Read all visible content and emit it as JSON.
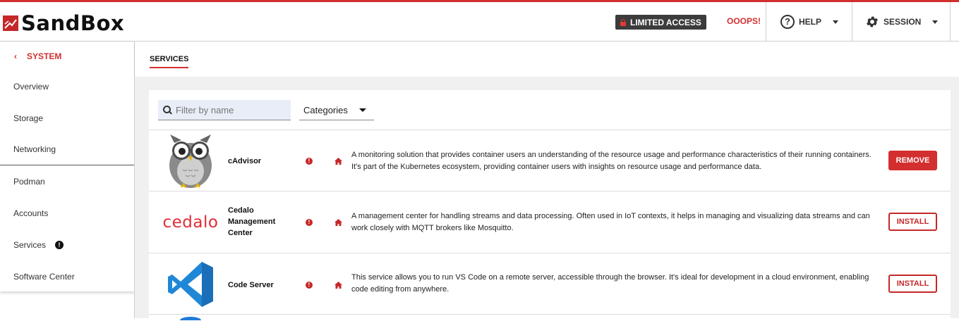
{
  "app": {
    "name": "SandBox"
  },
  "header": {
    "limited_access": "LIMITED ACCESS",
    "ooops": "OOOPS!",
    "help": "HELP",
    "session": "SESSION"
  },
  "sidebar": {
    "back_label": "SYSTEM",
    "items": [
      {
        "label": "Overview"
      },
      {
        "label": "Storage"
      },
      {
        "label": "Networking"
      },
      {
        "label": "Podman"
      },
      {
        "label": "Accounts"
      },
      {
        "label": "Services",
        "badge": "!"
      },
      {
        "label": "Software Center"
      }
    ]
  },
  "page": {
    "tab": "SERVICES",
    "filter_placeholder": "Filter by name",
    "categories_label": "Categories"
  },
  "services": [
    {
      "name": "cAdvisor",
      "description": "A monitoring solution that provides container users an understanding of the resource usage and performance characteristics of their running containers. It's part of the Kubernetes ecosystem, providing container users with insights on resource usage and performance data.",
      "action": "REMOVE",
      "installed": true,
      "logo": "owl-icon"
    },
    {
      "name": "Cedalo Management Center",
      "logo_text": "cedalo",
      "description": "A management center for handling streams and data processing. Often used in IoT contexts, it helps in managing and visualizing data streams and can work closely with MQTT brokers like Mosquitto.",
      "action": "INSTALL",
      "installed": false,
      "logo": "cedalo-logo"
    },
    {
      "name": "Code Server",
      "description": "This service allows you to run VS Code on a remote server, accessible through the browser. It's ideal for development in a cloud environment, enabling code editing from anywhere.",
      "action": "INSTALL",
      "installed": false,
      "logo": "vscode-icon"
    }
  ],
  "colors": {
    "accent": "#d32f2f",
    "dark": "#3c3c3c",
    "vscode": "#1f87d6"
  }
}
